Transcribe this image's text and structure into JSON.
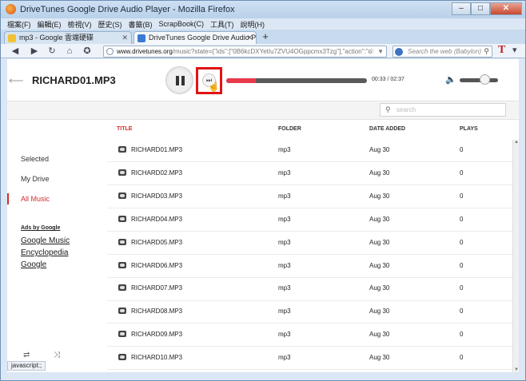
{
  "window": {
    "title": "DriveTunes Google Drive Audio Player - Mozilla Firefox",
    "controls": {
      "minimize": "–",
      "maximize": "□",
      "close": "✕"
    }
  },
  "menubar": [
    "檔案(F)",
    "編輯(E)",
    "檢視(V)",
    "歷史(S)",
    "書籤(B)",
    "ScrapBook(C)",
    "工具(T)",
    "說明(H)"
  ],
  "tabs": [
    {
      "label": "mp3 - Google 雲端硬碟",
      "active": false
    },
    {
      "label": "DriveTunes Google Drive Audio Pla...",
      "active": true
    }
  ],
  "newtab_label": "+",
  "navbar": {
    "url_host": "www.drivetunes.org",
    "url_rest": "/music?state={\"ids\":[\"0B6kcDXYetIu7ZVU4OGppcmx3Tzg\"],\"action\":\"o",
    "search_placeholder": "Search the web (Babylon)"
  },
  "player": {
    "track_title": "RICHARD01.MP3",
    "time": "00:33 / 02:37",
    "progress_fraction": 0.21,
    "volume_fraction": 0.65
  },
  "filter": {
    "search_placeholder": "search"
  },
  "sidebar": {
    "items": [
      {
        "label": "Selected",
        "active": false
      },
      {
        "label": "My Drive",
        "active": false
      },
      {
        "label": "All Music",
        "active": true
      }
    ],
    "ads_title": "Ads by Google",
    "ad_links": [
      "Google Music",
      "Encyclopedia",
      "Google"
    ],
    "repeat_icon": "⇄",
    "shuffle_icon": "⤨"
  },
  "table": {
    "headers": {
      "title": "TITLE",
      "folder": "FOLDER",
      "date": "DATE ADDED",
      "plays": "PLAYS"
    },
    "rows": [
      {
        "title": "RICHARD01.MP3",
        "folder": "mp3",
        "date": "Aug 30",
        "plays": "0"
      },
      {
        "title": "RICHARD02.MP3",
        "folder": "mp3",
        "date": "Aug 30",
        "plays": "0"
      },
      {
        "title": "RICHARD03.MP3",
        "folder": "mp3",
        "date": "Aug 30",
        "plays": "0"
      },
      {
        "title": "RICHARD04.MP3",
        "folder": "mp3",
        "date": "Aug 30",
        "plays": "0"
      },
      {
        "title": "RICHARD05.MP3",
        "folder": "mp3",
        "date": "Aug 30",
        "plays": "0"
      },
      {
        "title": "RICHARD06.MP3",
        "folder": "mp3",
        "date": "Aug 30",
        "plays": "0"
      },
      {
        "title": "RICHARD07.MP3",
        "folder": "mp3",
        "date": "Aug 30",
        "plays": "0"
      },
      {
        "title": "RICHARD08.MP3",
        "folder": "mp3",
        "date": "Aug 30",
        "plays": "0"
      },
      {
        "title": "RICHARD09.MP3",
        "folder": "mp3",
        "date": "Aug 30",
        "plays": "0"
      },
      {
        "title": "RICHARD10.MP3",
        "folder": "mp3",
        "date": "Aug 30",
        "plays": "0"
      }
    ]
  },
  "statusbar": "javascript:;",
  "colors": {
    "accent": "#d52b2b",
    "progress": "#e83a4a",
    "highlight": "#e01414"
  }
}
